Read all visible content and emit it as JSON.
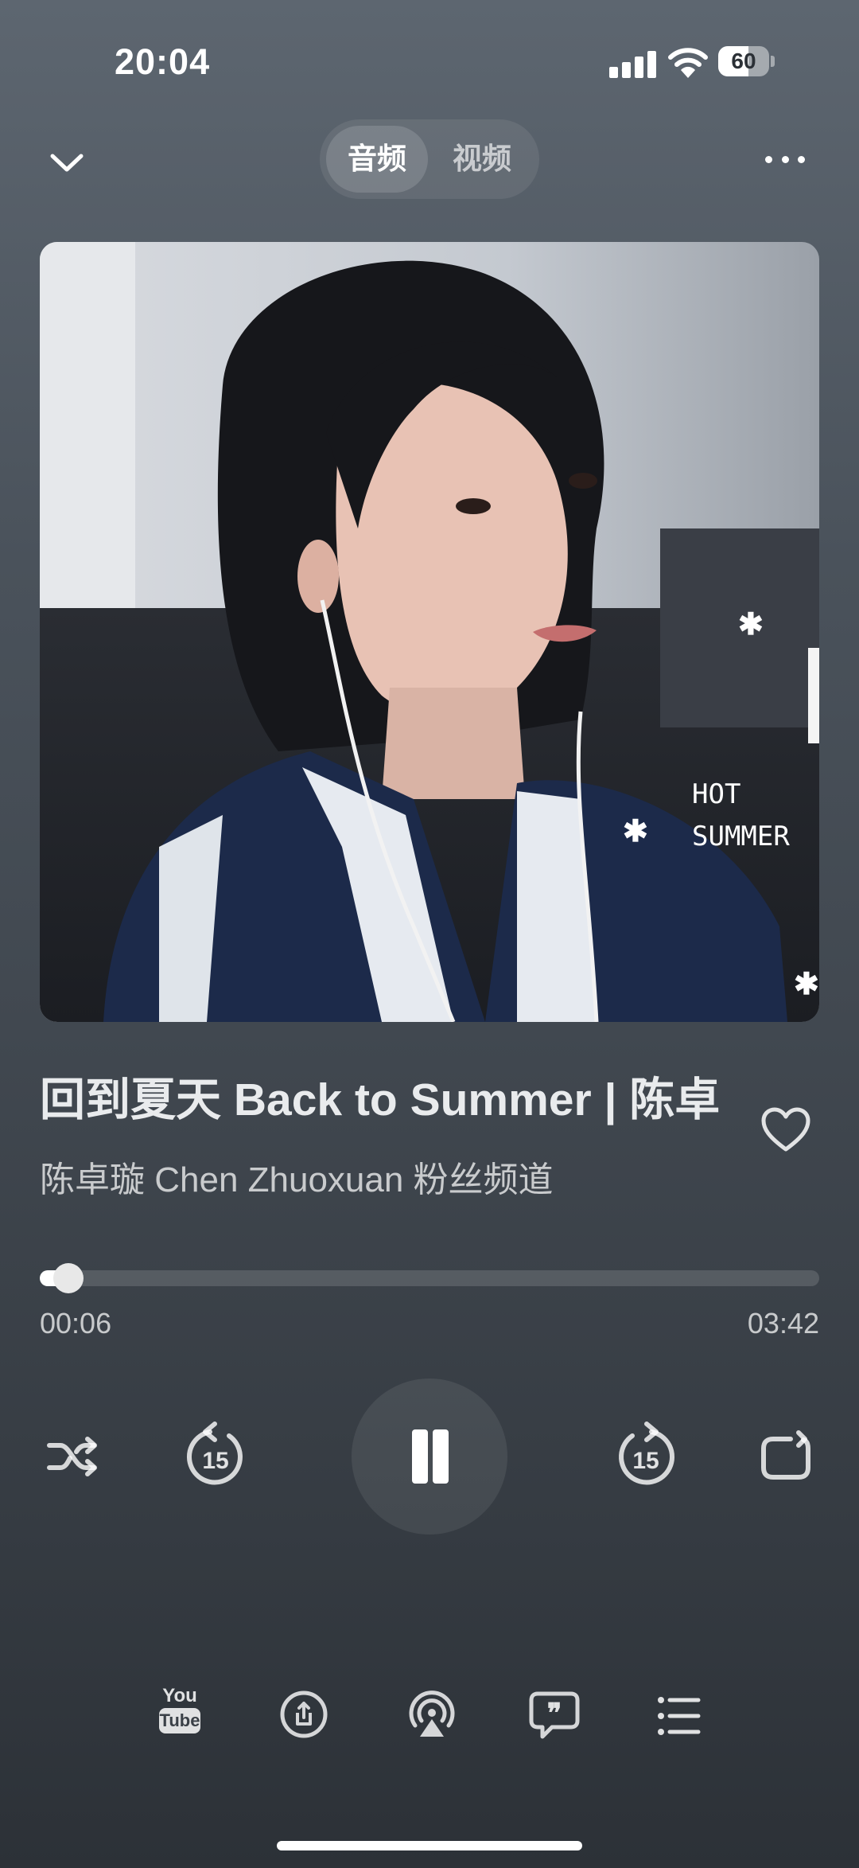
{
  "status_bar": {
    "time": "20:04",
    "battery_level": "60",
    "battery_fraction": 0.6
  },
  "header": {
    "tabs": [
      {
        "label": "音频",
        "active": true
      },
      {
        "label": "视频",
        "active": false
      }
    ]
  },
  "track": {
    "title": "回到夏天 Back to Summer | 陈卓",
    "channel": "陈卓璇 Chen Zhuoxuan 粉丝频道",
    "artwork_text": [
      "HOT",
      "SUMMER"
    ]
  },
  "progress": {
    "current": "00:06",
    "total": "03:42",
    "fraction": 0.037
  },
  "controls": {
    "skip_back_seconds": "15",
    "skip_forward_seconds": "15"
  },
  "bottom_bar": {
    "youtube_top": "You",
    "youtube_bottom": "Tube"
  },
  "colors": {
    "background_top": "#5d6670",
    "background_bottom": "#2c3137",
    "accent": "#ffffff"
  }
}
